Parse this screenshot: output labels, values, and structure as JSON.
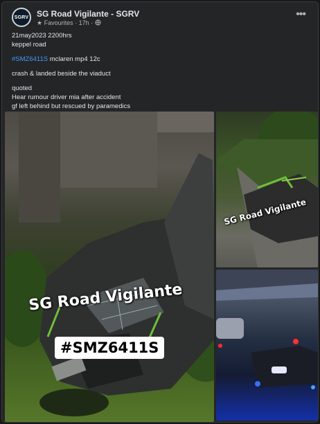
{
  "post": {
    "page_name": "SG Road Vigilante - SGRV",
    "avatar_text": "SGRV",
    "audience": "Favourites",
    "time": "17h",
    "lines": {
      "date": "21may2023 2200hrs",
      "location": "keppel road",
      "plate_hashtag": "#SMZ6411S",
      "car": "mclaren mp4 12c",
      "event": "crash & landed beside the viaduct",
      "quoted": "quoted",
      "rumour": "Hear rumour driver mia after accident",
      "gf": "gf left behind but rescued by paramedics"
    }
  },
  "photos": {
    "main_watermark": "SG Road Vigilante",
    "main_plate": "#SMZ6411S",
    "side_watermark": "SG Road Vigilante"
  },
  "icons": {
    "more": "more-options-icon",
    "audience": "star-icon"
  }
}
